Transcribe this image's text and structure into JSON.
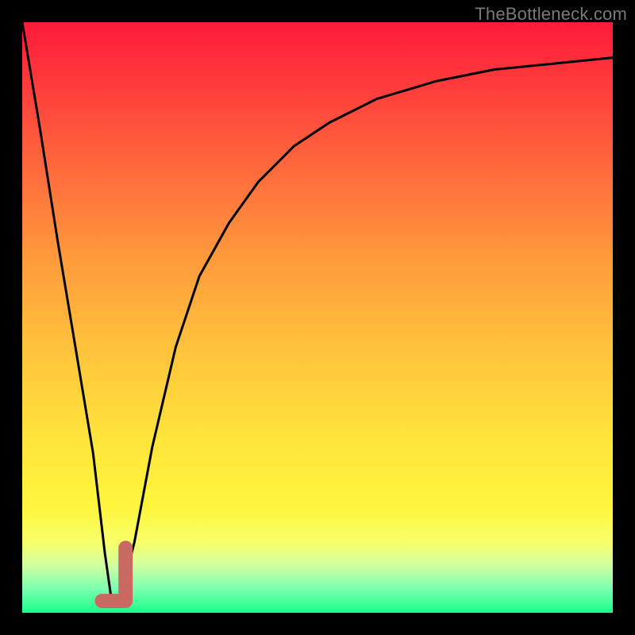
{
  "watermark": "TheBottleneck.com",
  "colors": {
    "page_bg": "#000000",
    "curve": "#000000",
    "marker": "#c86a62",
    "gradient_top": "#ff1a3a",
    "gradient_bottom": "#1aff8a"
  },
  "chart_data": {
    "type": "line",
    "title": "",
    "xlabel": "",
    "ylabel": "",
    "xlim": [
      0,
      100
    ],
    "ylim": [
      0,
      100
    ],
    "grid": false,
    "legend": false,
    "series": [
      {
        "name": "bottleneck-curve",
        "x": [
          0,
          3,
          6,
          9,
          12,
          14,
          15,
          16,
          17,
          19,
          22,
          26,
          30,
          35,
          40,
          46,
          52,
          60,
          70,
          80,
          90,
          100
        ],
        "y": [
          100,
          82,
          63,
          45,
          27,
          10,
          3,
          2,
          4,
          12,
          28,
          45,
          57,
          66,
          73,
          79,
          83,
          87,
          90,
          92,
          93,
          94
        ]
      }
    ],
    "marker": {
      "name": "selected-point",
      "shape": "J",
      "x_range": [
        13.5,
        17.5
      ],
      "y_range": [
        2,
        11
      ],
      "color": "#c86a62"
    },
    "background_gradient": {
      "orientation": "vertical",
      "stops": [
        {
          "pos": 0.0,
          "color": "#ff1a3a"
        },
        {
          "pos": 0.55,
          "color": "#ffc23c"
        },
        {
          "pos": 0.82,
          "color": "#fff53c"
        },
        {
          "pos": 1.0,
          "color": "#1aff8a"
        }
      ]
    }
  }
}
